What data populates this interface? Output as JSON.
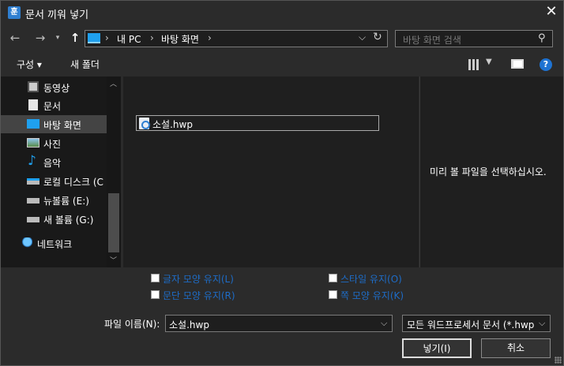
{
  "window": {
    "title": "문서 끼워 넣기",
    "app_icon_glyph": "훈"
  },
  "address": {
    "segments": [
      "내 PC",
      "바탕 화면"
    ]
  },
  "search": {
    "placeholder": "바탕 화면 검색"
  },
  "toolbar": {
    "organize": "구성 ▾",
    "new_folder": "새 폴더"
  },
  "sidebar": {
    "items": [
      {
        "label": "동영상",
        "icon": "video-icon"
      },
      {
        "label": "문서",
        "icon": "document-icon"
      },
      {
        "label": "바탕 화면",
        "icon": "desktop-icon",
        "selected": true
      },
      {
        "label": "사진",
        "icon": "pictures-icon"
      },
      {
        "label": "음악",
        "icon": "music-icon"
      },
      {
        "label": "로컬 디스크 (C",
        "icon": "local-disk-icon"
      },
      {
        "label": "뉴볼륨 (E:)",
        "icon": "drive-icon"
      },
      {
        "label": "새 볼륨 (G:)",
        "icon": "drive-icon"
      },
      {
        "label": "네트워크",
        "icon": "network-icon"
      }
    ]
  },
  "files": [
    {
      "name": "소설.hwp",
      "icon": "hwp-file-icon"
    }
  ],
  "preview": {
    "text": "미리 볼 파일을 선택하십시오."
  },
  "options": {
    "keep_char": "글자 모양 유지(L)",
    "keep_style": "스타일 유지(O)",
    "keep_para": "문단 모양 유지(R)",
    "keep_page": "쪽 모양 유지(K)"
  },
  "filename": {
    "label": "파일 이름(N):",
    "value": "소설.hwp"
  },
  "filetype": {
    "value": "모든 워드프로세서 문서 (*.hwp"
  },
  "buttons": {
    "insert": "넣기(I)",
    "cancel": "취소"
  },
  "colors": {
    "link_blue": "#1e6cc7",
    "accent": "#1fa0ee"
  }
}
